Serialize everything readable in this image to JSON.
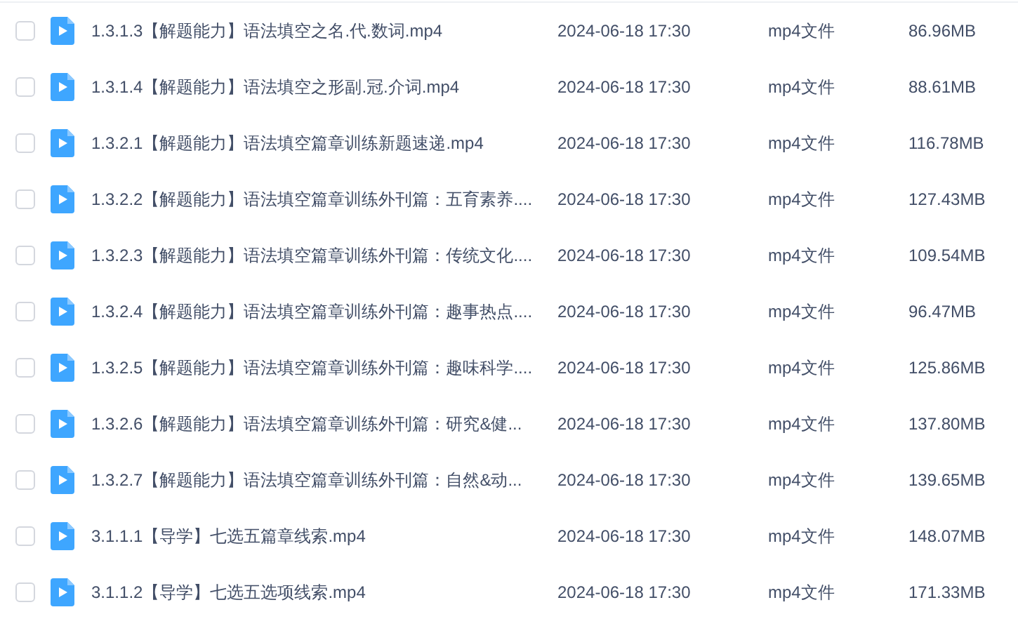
{
  "files": [
    {
      "name": "1.3.1.3【解题能力】语法填空之名.代.数词.mp4",
      "date": "2024-06-18 17:30",
      "type": "mp4文件",
      "size": "86.96MB",
      "checked": false
    },
    {
      "name": "1.3.1.4【解题能力】语法填空之形副.冠.介词.mp4",
      "date": "2024-06-18 17:30",
      "type": "mp4文件",
      "size": "88.61MB",
      "checked": false
    },
    {
      "name": "1.3.2.1【解题能力】语法填空篇章训练新题速递.mp4",
      "date": "2024-06-18 17:30",
      "type": "mp4文件",
      "size": "116.78MB",
      "checked": false
    },
    {
      "name": "1.3.2.2【解题能力】语法填空篇章训练外刊篇：五育素养....",
      "date": "2024-06-18 17:30",
      "type": "mp4文件",
      "size": "127.43MB",
      "checked": false
    },
    {
      "name": "1.3.2.3【解题能力】语法填空篇章训练外刊篇：传统文化....",
      "date": "2024-06-18 17:30",
      "type": "mp4文件",
      "size": "109.54MB",
      "checked": false
    },
    {
      "name": "1.3.2.4【解题能力】语法填空篇章训练外刊篇：趣事热点....",
      "date": "2024-06-18 17:30",
      "type": "mp4文件",
      "size": "96.47MB",
      "checked": false
    },
    {
      "name": "1.3.2.5【解题能力】语法填空篇章训练外刊篇：趣味科学....",
      "date": "2024-06-18 17:30",
      "type": "mp4文件",
      "size": "125.86MB",
      "checked": false
    },
    {
      "name": "1.3.2.6【解题能力】语法填空篇章训练外刊篇：研究&健...",
      "date": "2024-06-18 17:30",
      "type": "mp4文件",
      "size": "137.80MB",
      "checked": false
    },
    {
      "name": "1.3.2.7【解题能力】语法填空篇章训练外刊篇：自然&动...",
      "date": "2024-06-18 17:30",
      "type": "mp4文件",
      "size": "139.65MB",
      "checked": false
    },
    {
      "name": "3.1.1.1【导学】七选五篇章线索.mp4",
      "date": "2024-06-18 17:30",
      "type": "mp4文件",
      "size": "148.07MB",
      "checked": false
    },
    {
      "name": "3.1.1.2【导学】七选五选项线索.mp4",
      "date": "2024-06-18 17:30",
      "type": "mp4文件",
      "size": "171.33MB",
      "checked": false
    }
  ]
}
